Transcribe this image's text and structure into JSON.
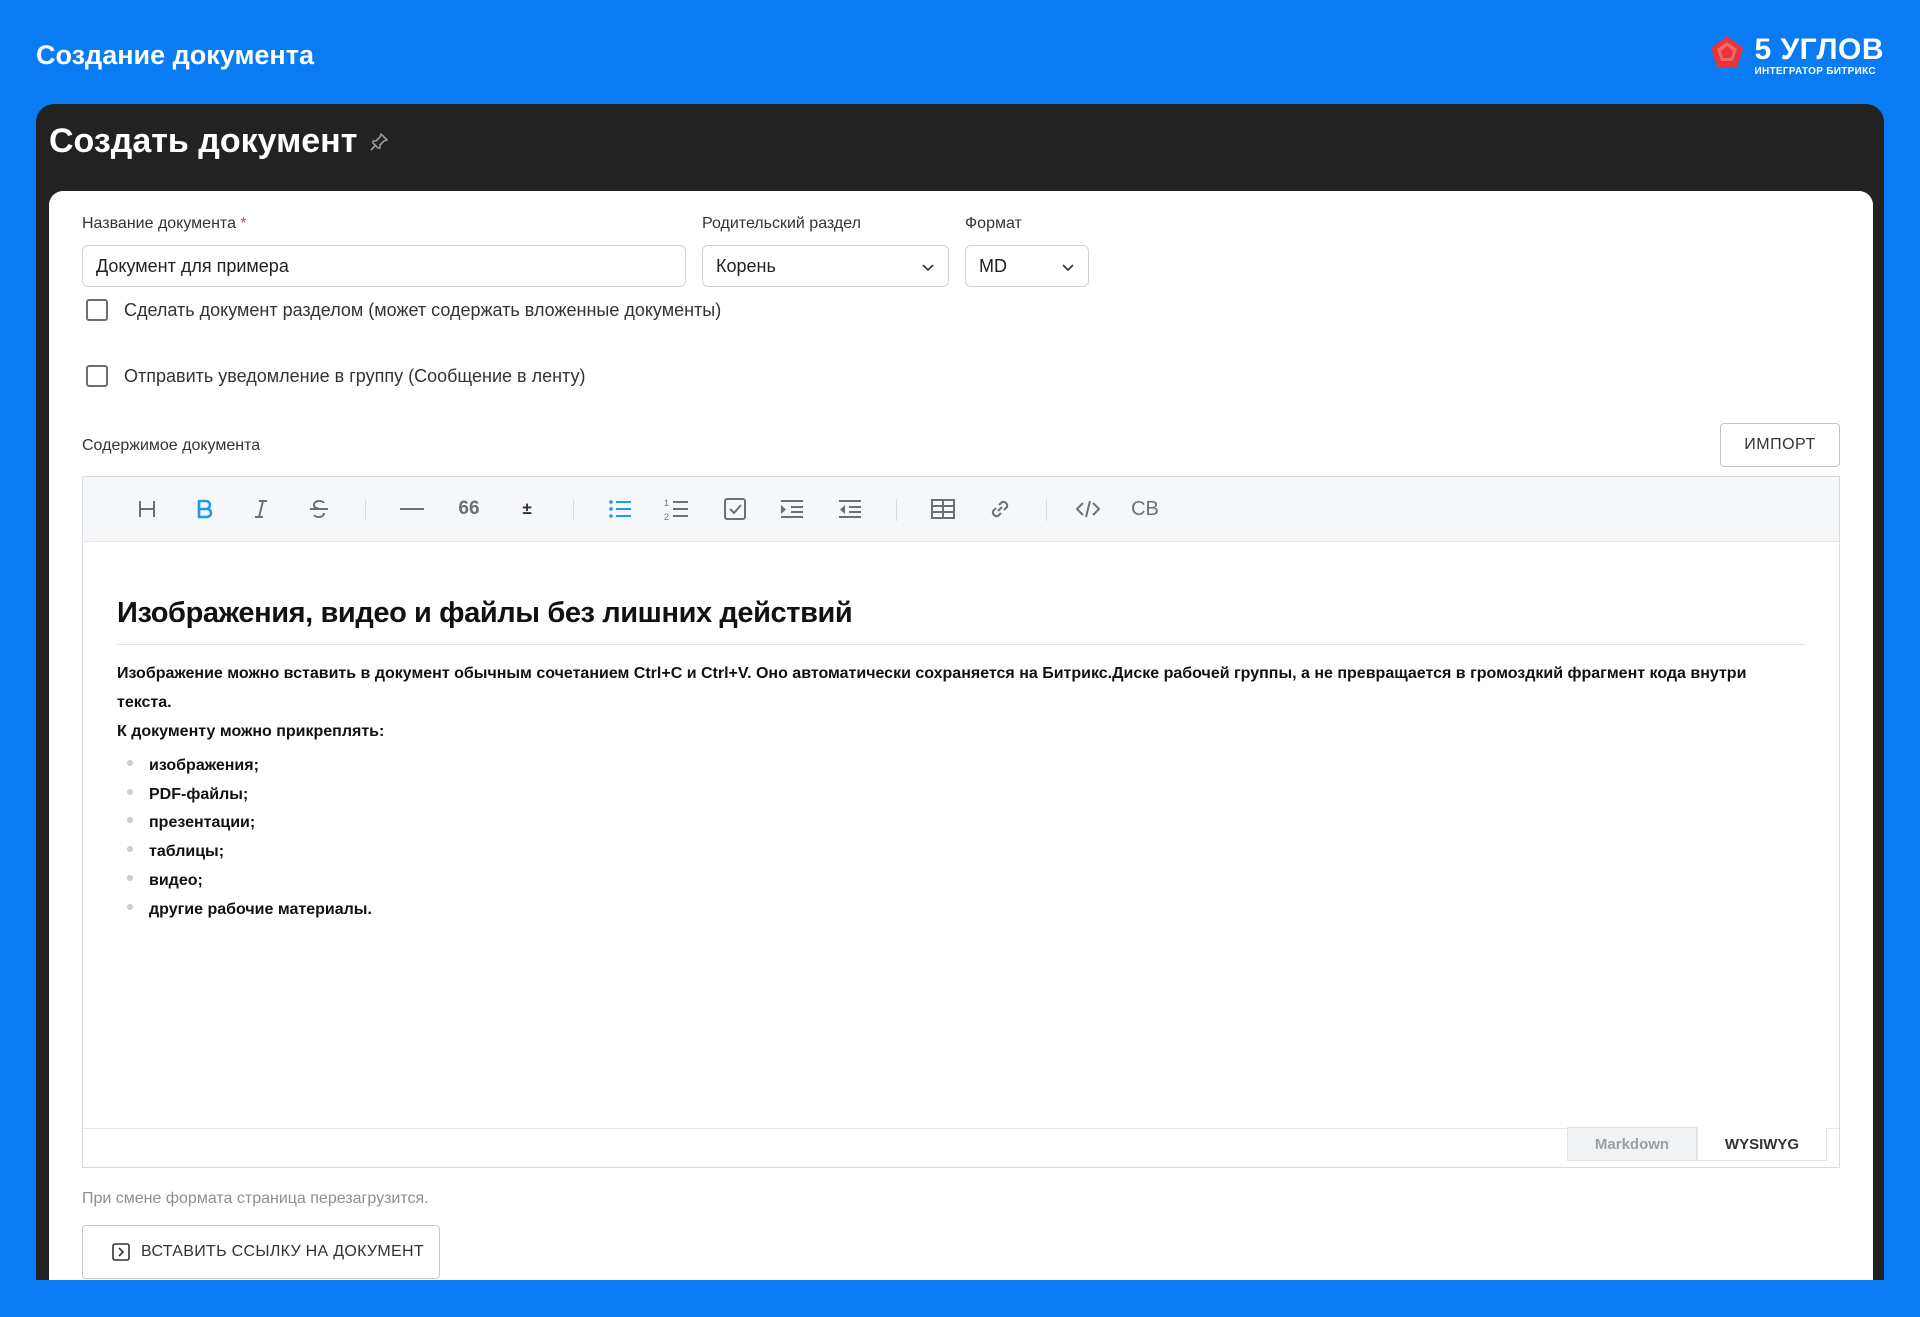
{
  "banner": {
    "title": "Создание документа",
    "logo_name": "5 УГЛОВ",
    "logo_sub": "ИНТЕГРАТОР БИТРИКС"
  },
  "window": {
    "title": "Создать документ"
  },
  "form": {
    "name_label": "Название документа",
    "name_required_mark": "*",
    "name_value": "Документ для примера",
    "parent_label": "Родительский раздел",
    "parent_value": "Корень",
    "format_label": "Формат",
    "format_value": "MD",
    "checkbox_section_label": "Сделать документ разделом (может содержать вложенные документы)",
    "checkbox_section_checked": false,
    "checkbox_notify_label": "Отправить уведомление в группу (Сообщение в ленту)",
    "checkbox_notify_checked": false,
    "content_label": "Содержимое документа",
    "import_label": "ИМПОРТ"
  },
  "toolbar": {
    "buttons": [
      {
        "name": "heading-icon",
        "active": false
      },
      {
        "name": "bold-icon",
        "active": true
      },
      {
        "name": "italic-icon",
        "active": false
      },
      {
        "name": "strikethrough-icon",
        "active": false
      },
      {
        "name": "horizontal-rule-icon",
        "active": false
      },
      {
        "name": "quote-icon",
        "active": false
      },
      {
        "name": "plus-minus-icon",
        "active": false
      },
      {
        "name": "bullet-list-icon",
        "active": true
      },
      {
        "name": "numbered-list-icon",
        "active": false
      },
      {
        "name": "task-list-icon",
        "active": false
      },
      {
        "name": "indent-icon",
        "active": false
      },
      {
        "name": "outdent-icon",
        "active": false
      },
      {
        "name": "table-icon",
        "active": false
      },
      {
        "name": "link-icon",
        "active": false
      },
      {
        "name": "code-icon",
        "active": false
      },
      {
        "name": "code-block-icon",
        "active": false
      }
    ],
    "quote_glyph": "66",
    "plusminus_glyph": "±",
    "codeblock_glyph": "CB",
    "active_color": "#1e9bf0",
    "icon_color": "#6b7078"
  },
  "document": {
    "heading": "Изображения, видео и файлы без лишних действий",
    "paragraph1": "Изображение можно вставить в документ обычным сочетанием Ctrl+C и Ctrl+V. Оно автоматически сохраняется на Битрикс.Диске рабочей группы, а не превращается в громоздкий фрагмент кода внутри текста.",
    "paragraph2": "К документу можно прикреплять:",
    "items": [
      "изображения;",
      "PDF-файлы;",
      "презентации;",
      "таблицы;",
      "видео;",
      "другие рабочие материалы."
    ]
  },
  "editor_modes": {
    "markdown": "Markdown",
    "wysiwyg": "WYSIWYG",
    "active": "WYSIWYG"
  },
  "footer": {
    "hint": "При смене формата страница перезагрузится.",
    "insert_link_label": "ВСТАВИТЬ ССЫЛКУ НА ДОКУМЕНТ"
  },
  "colors": {
    "brand_blue": "#0a7cf3",
    "dark_header": "#222222",
    "logo_red": "#e8343a"
  }
}
